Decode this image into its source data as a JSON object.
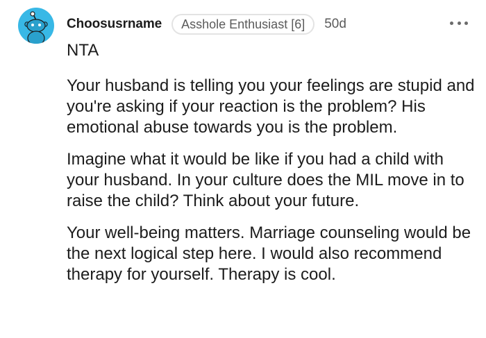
{
  "comment": {
    "username": "Choosusrname",
    "flair": "Asshole Enthusiast [6]",
    "age": "50d",
    "avatar_icon": "snoo-avatar-icon",
    "more_icon": "more-options-icon",
    "colors": {
      "avatar_bg": "#38b8e6",
      "text": "#1c1c1c",
      "meta": "#5a5a5a",
      "flair_border": "#e3e3e3"
    },
    "paragraphs": [
      "NTA",
      "Your husband is telling you your feelings are stupid and you're asking if your reaction is the problem? His emotional abuse towards you is the problem.",
      "Imagine what it would be like if you had a child with your husband. In your culture does the MIL move in to raise the child? Think about your future.",
      "Your well-being matters. Marriage counseling would be the next logical step here. I would also recommend therapy for yourself. Therapy is cool."
    ]
  }
}
